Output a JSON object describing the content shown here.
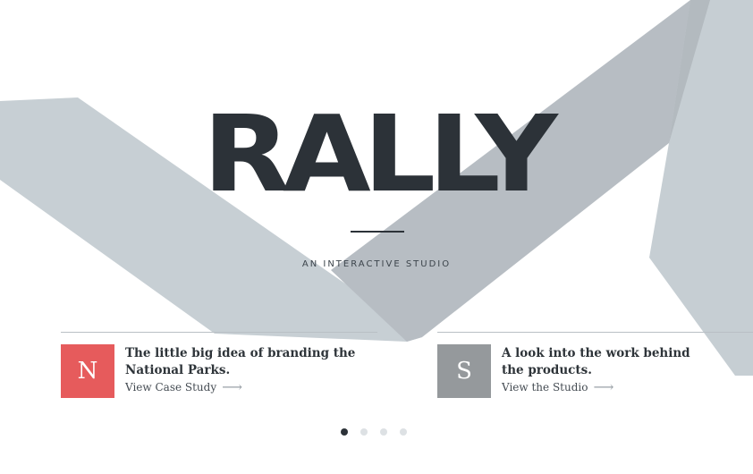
{
  "hero": {
    "logo_text": "RALLY",
    "tagline": "AN INTERACTIVE STUDIO"
  },
  "cards": [
    {
      "badge_letter": "N",
      "badge_color": "#e65b5c",
      "title": "The little big idea of branding the National Parks.",
      "link_label": "View Case Study",
      "arrow_icon": "arrow-right-icon"
    },
    {
      "badge_letter": "S",
      "badge_color": "#95999c",
      "title": "A look into the work behind the products.",
      "link_label": "View the Studio",
      "arrow_icon": "arrow-right-icon"
    }
  ],
  "pagination": {
    "count": 4,
    "active_index": 0
  },
  "colors": {
    "background": "#ffffff",
    "shape_light": "#c7cfd4",
    "shape_mid": "#b6bcc2",
    "text_dark": "#2c3238"
  }
}
